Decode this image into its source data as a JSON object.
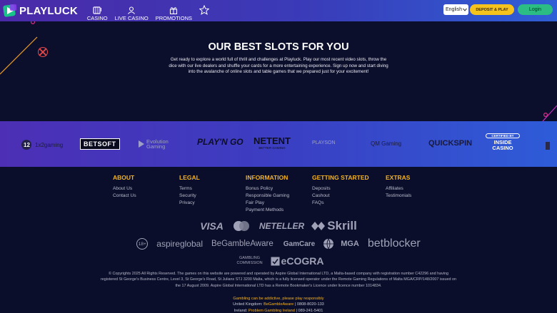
{
  "brand": {
    "name": "PLAYLUCK"
  },
  "nav": {
    "casino": "CASINO",
    "live_casino": "LIVE CASINO",
    "promotions": "PROMOTIONS"
  },
  "header": {
    "language": "English",
    "deposit_label": "DEPOSIT & PLAY",
    "login_label": "Login"
  },
  "hero": {
    "title": "OUR BEST SLOTS FOR YOU",
    "text": "Get ready to explore a world full of thrill and challenges at Playluck. Play our most recent video slots, throw the dice with our live dealers and shuffle your cards for a more entertaining experience. Sign up now and start diving into the avalanche of online slots and table games that we prepared just for your excitement!"
  },
  "providers": [
    "1x2gaming",
    "BETSOFT",
    "Evolution Gaming",
    "PLAY'N GO",
    "NETENT",
    "PLAYSON",
    "QM Gaming",
    "QUICKSPIN",
    "INSIDE CASINO"
  ],
  "provider_extra": {
    "netent_sub": "BETTER GAMING",
    "inside_certified": "CERTIFIED BY"
  },
  "footer": {
    "columns": [
      {
        "title": "ABOUT",
        "links": [
          "About Us",
          "Contact Us"
        ]
      },
      {
        "title": "LEGAL",
        "links": [
          "Terms",
          "Security",
          "Privacy"
        ]
      },
      {
        "title": "INFORMATION",
        "links": [
          "Bonus Policy",
          "Responsible Gaming",
          "Fair Play",
          "Payment Methods"
        ]
      },
      {
        "title": "GETTING STARTED",
        "links": [
          "Deposits",
          "Cashout",
          "FAQs"
        ]
      },
      {
        "title": "EXTRAS",
        "links": [
          "Affiliates",
          "Testimonials"
        ]
      }
    ],
    "payments": [
      "VISA",
      "NETELLER",
      "Skrill"
    ],
    "responsible": [
      "18+",
      "aspireglobal",
      "BeGambleAware",
      "GamCare",
      "MGA",
      "betblocker"
    ],
    "regulators": [
      "GAMBLING COMMISSION",
      "eCOGRA"
    ],
    "legal_text": "© Copyrights 2025 All Rights Reserved. The games on this website are powered and operated by Aspire Global International LTD, a Malta-based company with registration number C42296 and having registered St George's Business Centre, Level 3, St George's Road, St Julians STJ 3200 Malta, which is a fully licensed operator under the Remote Gaming Regulations of Malta MGA/CRP/148/2007 issued on the 17 August 2009. Aspire Global International LTD has a Remote Bookmaker's Licence under licence number 1014834.",
    "warning": "Gambling can be addictive, please play responsibly",
    "help_uk_prefix": "United Kingdom:",
    "help_uk_link": "BeGambleAware",
    "help_uk_phone": "| 0808-8020-133",
    "help_ie_prefix": "Ireland:",
    "help_ie_link": "Problem Gambling Ireland",
    "help_ie_phone": "| 089-241-5401"
  },
  "colors": {
    "accent_yellow": "#f7b21a",
    "login_green": "#2bbd83",
    "header_purple": "#4b2aa8",
    "background": "#0c0f2c"
  }
}
